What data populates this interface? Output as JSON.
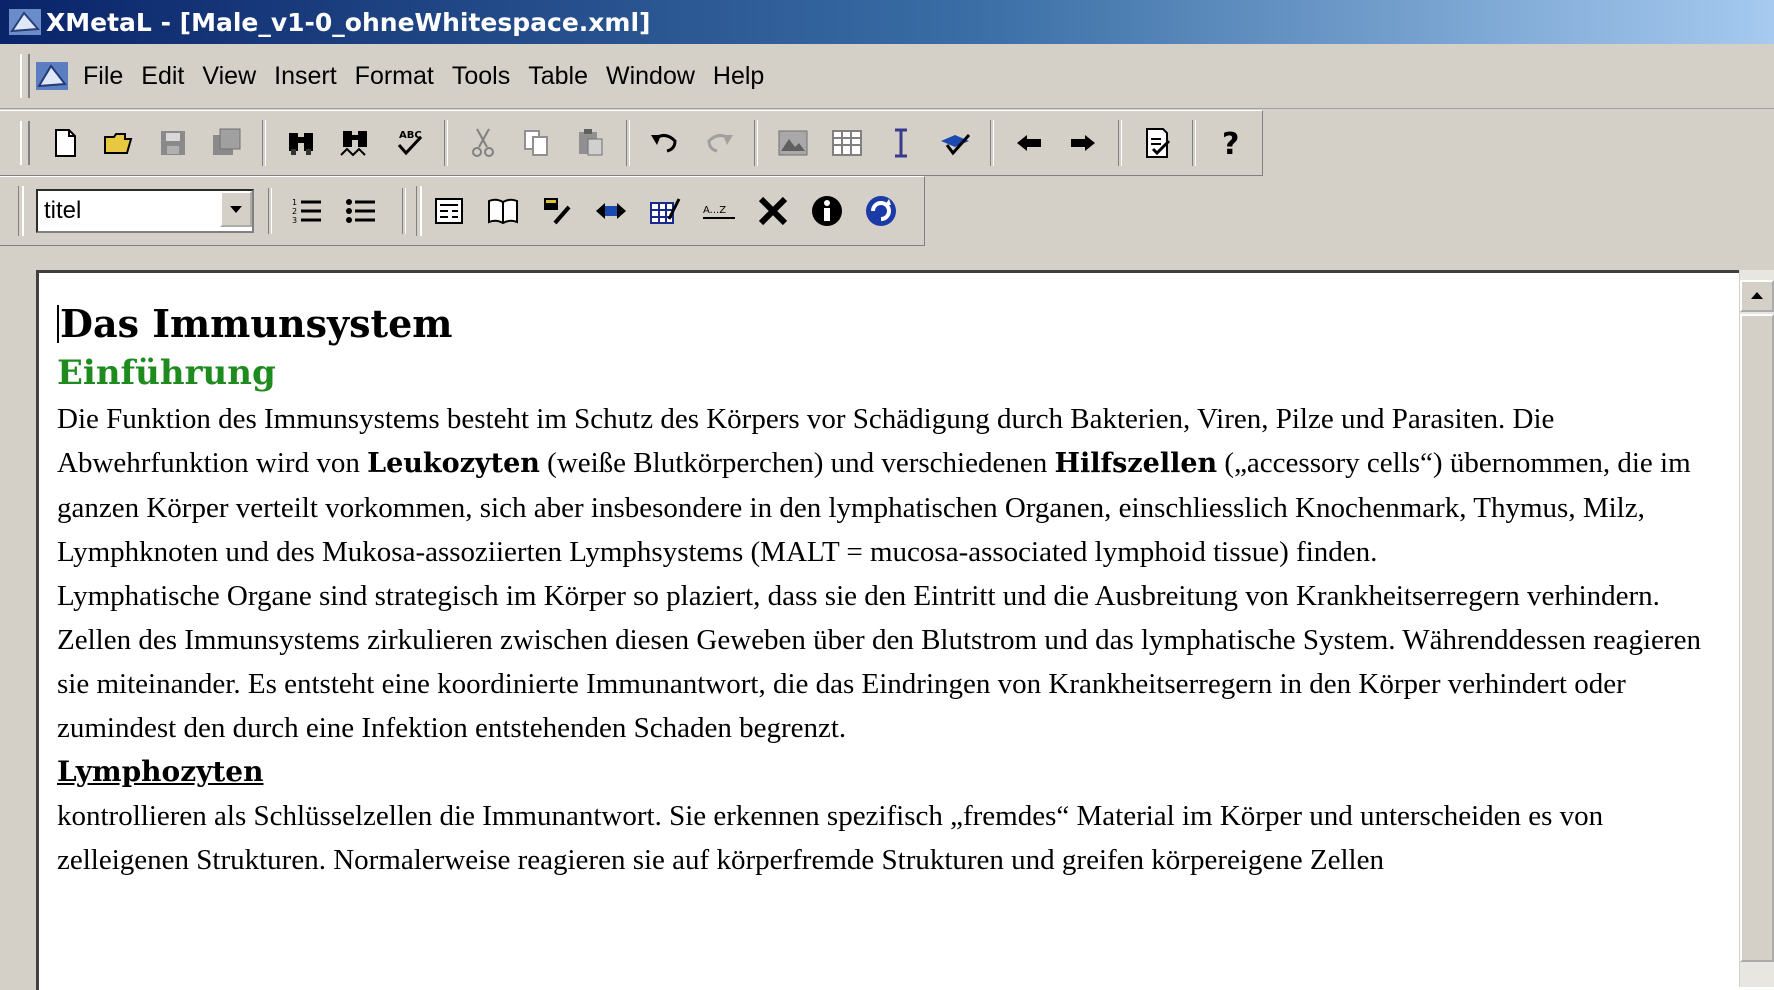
{
  "window": {
    "title": "XMetaL - [Male_v1-0_ohneWhitespace.xml]"
  },
  "menu": [
    "File",
    "Edit",
    "View",
    "Insert",
    "Format",
    "Tools",
    "Table",
    "Window",
    "Help"
  ],
  "toolbar2": {
    "style_select_value": "titel"
  },
  "document": {
    "title": "Das Immunsystem",
    "section_heading": "Einführung",
    "p1_a": "Die Funktion des Immunsystems besteht im Schutz des Körpers vor Schädigung durch Bakterien, Viren, Pilze und Parasiten. Die Abwehrfunktion wird von ",
    "p1_b1": "Leukozyten",
    "p1_c": " (weiße Blutkörperchen) und verschiedenen ",
    "p1_b2": "Hilfszellen",
    "p1_d": " („accessory cells“) übernommen, die im ganzen Körper verteilt vorkommen, sich aber insbesondere in den lymphatischen Organen, einschliesslich Knochenmark, Thymus, Milz, Lymphknoten und des Mukosa-assoziierten Lymphsystems (MALT = mucosa-associated lymphoid tissue) finden.",
    "p2": "Lymphatische Organe sind strategisch im Körper so plaziert, dass sie den Eintritt und die Ausbreitung von Krankheitserregern verhindern. Zellen des Immunsystems zirkulieren zwischen diesen Geweben über den Blutstrom und das lymphatische System. Währenddessen reagieren sie miteinander. Es entsteht eine koordinierte Immunantwort, die das Eindringen von Krankheitserregern in den Körper verhindert oder zumindest den durch eine Infektion entstehenden Schaden begrenzt.",
    "subheading": "Lymphozyten",
    "p3": "kontrollieren als Schlüsselzellen die Immunantwort. Sie erkennen spezifisch „fremdes“ Material im Körper und unterscheiden es von zelleigenen Strukturen. Normalerweise reagieren sie auf körperfremde Strukturen und greifen körpereigene Zellen"
  },
  "colors": {
    "heading_green": "#1e8b1e",
    "titlebar_start": "#0a246a",
    "titlebar_end": "#a6caf0"
  }
}
